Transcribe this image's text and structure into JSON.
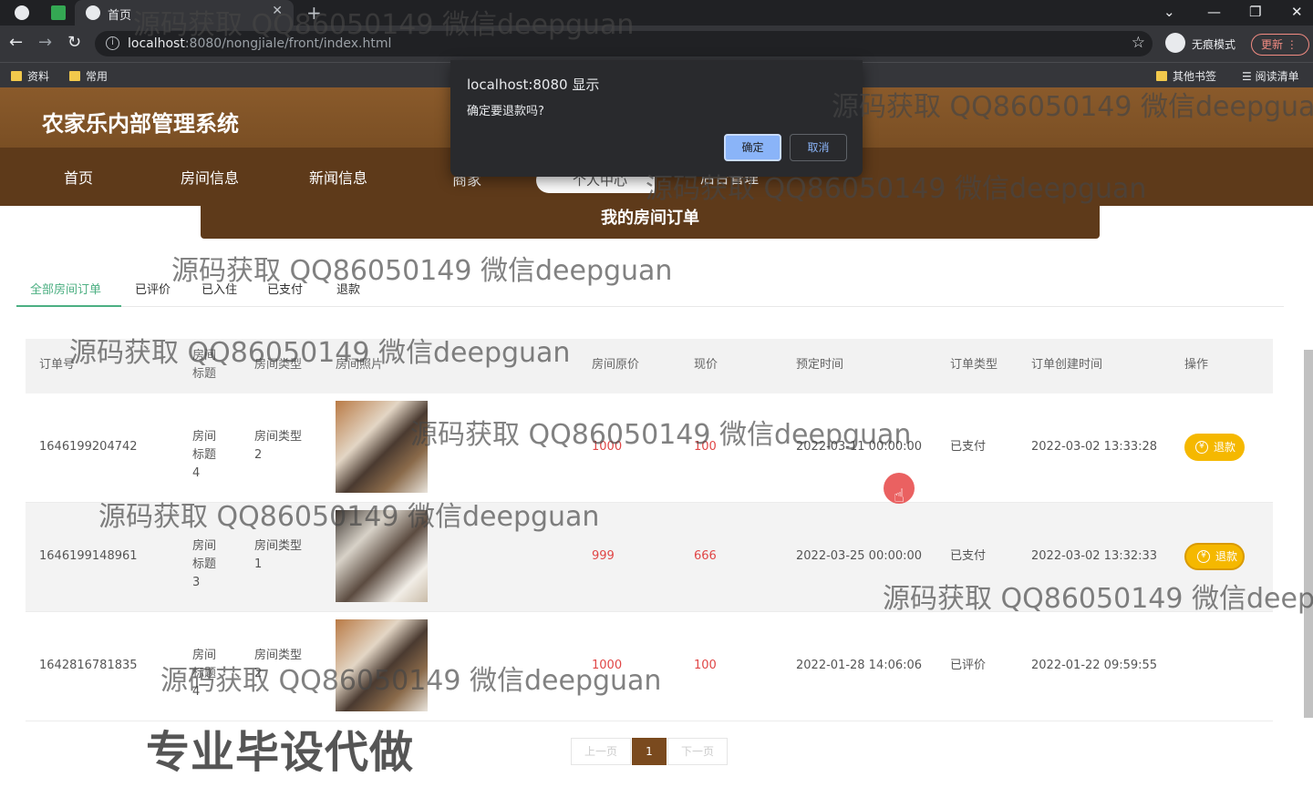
{
  "browser": {
    "tab_title": "首页",
    "url_host": "localhost",
    "url_path": ":8080/nongjiale/front/index.html",
    "incognito_label": "无痕模式",
    "update_label": "更新",
    "bookmarks": [
      "资料",
      "常用"
    ],
    "bookmarks_right": [
      "其他书签",
      "阅读清单"
    ]
  },
  "site": {
    "title": "农家乐内部管理系统",
    "nav": [
      "首页",
      "房间信息",
      "新闻信息",
      "商家",
      "后台管理"
    ],
    "search_text": "个人中心"
  },
  "banner": "我的房间订单",
  "order_tabs": [
    "全部房间订单",
    "已评价",
    "已入住",
    "已支付",
    "退款"
  ],
  "table": {
    "headers": [
      "订单号",
      "房间标题",
      "房间类型",
      "房间照片",
      "房间原价",
      "现价",
      "预定时间",
      "订单类型",
      "订单创建时间",
      "操作"
    ],
    "rows": [
      {
        "order_no": "1646199204742",
        "title": "房间标题4",
        "type": "房间类型2",
        "orig_price": "1000",
        "price": "100",
        "book_time": "2022-03-11 00:00:00",
        "status": "已支付",
        "created": "2022-03-02 13:33:28",
        "action": "退款"
      },
      {
        "order_no": "1646199148961",
        "title": "房间标题3",
        "type": "房间类型1",
        "orig_price": "999",
        "price": "666",
        "book_time": "2022-03-25 00:00:00",
        "status": "已支付",
        "created": "2022-03-02 13:32:33",
        "action": "退款"
      },
      {
        "order_no": "1642816781835",
        "title": "房间标题4",
        "type": "房间类型2",
        "orig_price": "1000",
        "price": "100",
        "book_time": "2022-01-28 14:06:06",
        "status": "已评价",
        "created": "2022-01-22 09:59:55",
        "action": ""
      }
    ]
  },
  "pager": {
    "prev": "上一页",
    "current": "1",
    "next": "下一页"
  },
  "dialog": {
    "title": "localhost:8080 显示",
    "message": "确定要退款吗?",
    "ok": "确定",
    "cancel": "取消"
  },
  "watermark": "源码获取 QQ86050149 微信deepguan",
  "promo": "专业毕设代做",
  "colors": {
    "header": "#7a4f24",
    "nav": "#5e3a1a",
    "accent": "#4caf82",
    "refund": "#f5b800",
    "price": "#e04646"
  }
}
